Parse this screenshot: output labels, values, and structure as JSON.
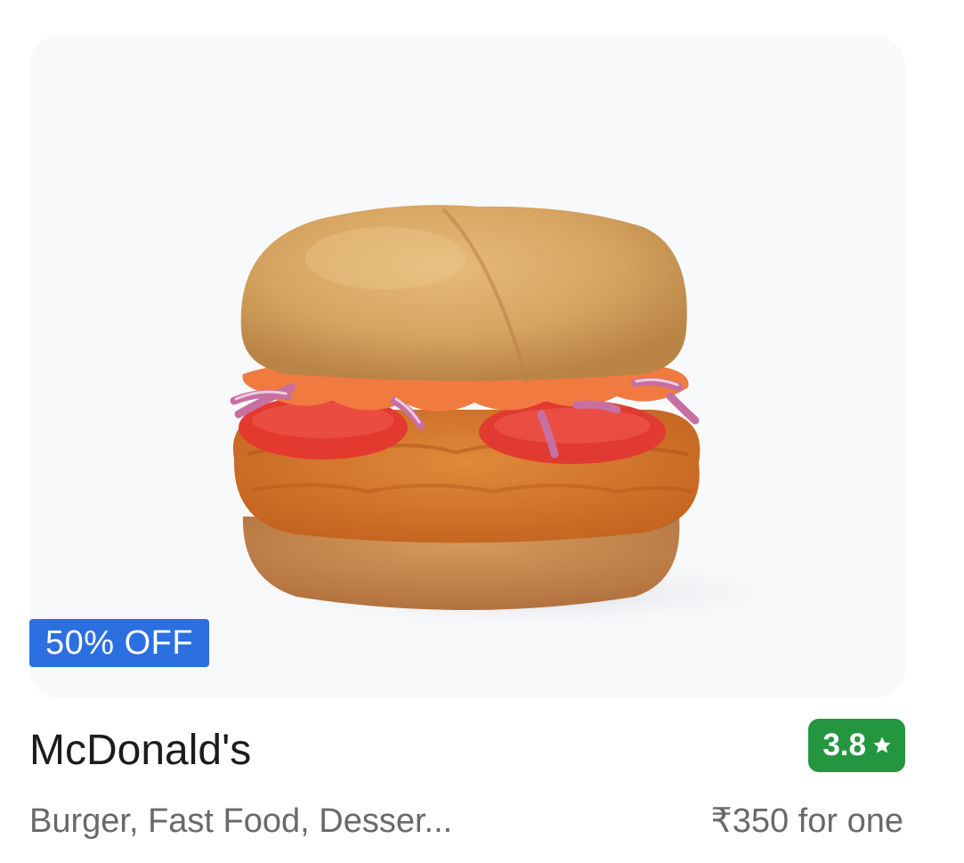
{
  "restaurant": {
    "name": "McDonald's",
    "cuisines": "Burger, Fast Food, Desser...",
    "price": "₹350 for one",
    "rating": "3.8",
    "offer": "50% OFF"
  },
  "icons": {
    "rating_star": "star-icon",
    "image": "burger-image"
  },
  "colors": {
    "offer_badge": "#2b6fe0",
    "rating_badge": "#24963f",
    "image_bg": "#f8f9fb",
    "title_text": "#1c1c1c",
    "secondary_text": "#696969"
  }
}
